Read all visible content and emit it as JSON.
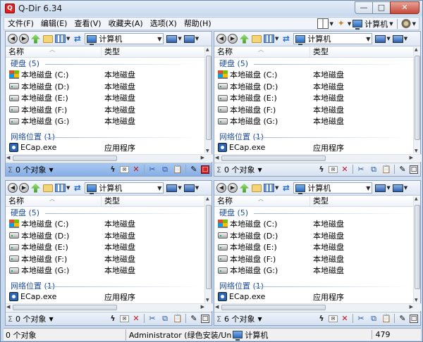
{
  "window": {
    "title": "Q-Dir 6.34",
    "icon_letter": "Q"
  },
  "menu": [
    {
      "label": "文件(F)"
    },
    {
      "label": "编辑(E)"
    },
    {
      "label": "查看(V)"
    },
    {
      "label": "收藏夹(A)"
    },
    {
      "label": "选项(X)"
    },
    {
      "label": "帮助(H)"
    }
  ],
  "menu_right": {
    "location": "计算机"
  },
  "pane": {
    "address": "计算机",
    "columns": {
      "name": "名称",
      "type": "类型"
    },
    "groups": {
      "drives": "硬盘 (5)",
      "network": "网络位置 (1)"
    },
    "drives": [
      {
        "name": "本地磁盘 (C:)",
        "type": "本地磁盘",
        "icon": "windows-drive"
      },
      {
        "name": "本地磁盘 (D:)",
        "type": "本地磁盘",
        "icon": "drive"
      },
      {
        "name": "本地磁盘 (E:)",
        "type": "本地磁盘",
        "icon": "drive"
      },
      {
        "name": "本地磁盘 (F:)",
        "type": "本地磁盘",
        "icon": "drive"
      },
      {
        "name": "本地磁盘 (G:)",
        "type": "本地磁盘",
        "icon": "drive"
      }
    ],
    "network_items": [
      {
        "name": "ECap.exe",
        "type": "应用程序",
        "icon": "app"
      }
    ]
  },
  "pane_status": {
    "tl": "0 个对象",
    "tr": "0 个对象",
    "bl": "0 个对象",
    "br": "6 个对象"
  },
  "statusbar": {
    "left": "0 个对象",
    "middle": "Administrator (绿色安装/Un",
    "middle_location": "计算机",
    "right": "479"
  }
}
